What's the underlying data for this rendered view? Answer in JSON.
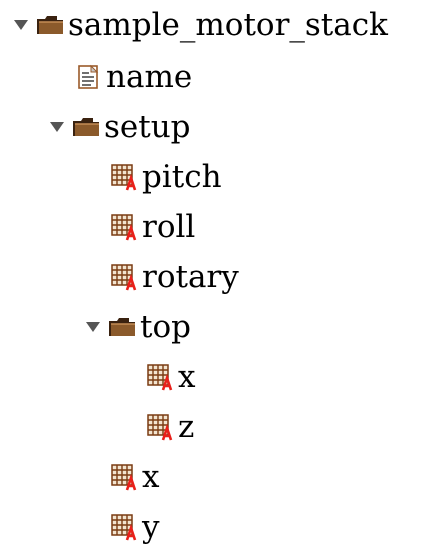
{
  "tree": {
    "root": {
      "label": "sample_motor_stack",
      "expanded": true,
      "icon": "folder-icon"
    },
    "nodes": [
      {
        "label": "name",
        "icon": "text-document-icon"
      },
      {
        "label": "setup",
        "expanded": true,
        "icon": "folder-icon"
      },
      {
        "label": "pitch",
        "icon": "array-dataset-icon"
      },
      {
        "label": "roll",
        "icon": "array-dataset-icon"
      },
      {
        "label": "rotary",
        "icon": "array-dataset-icon"
      },
      {
        "label": "top",
        "expanded": true,
        "icon": "folder-icon"
      },
      {
        "label": "x",
        "icon": "array-dataset-icon"
      },
      {
        "label": "z",
        "icon": "array-dataset-icon"
      },
      {
        "label": "x",
        "icon": "array-dataset-icon"
      },
      {
        "label": "y",
        "icon": "array-dataset-icon"
      }
    ]
  },
  "colors": {
    "folder_body": "#8b5a2b",
    "folder_dark": "#3a2210",
    "dataset_grid": "#7a3b12",
    "dataset_accent": "#e8201a",
    "document_border": "#9a5a2a",
    "document_fill": "#ffffff",
    "toggle": "#555555"
  }
}
